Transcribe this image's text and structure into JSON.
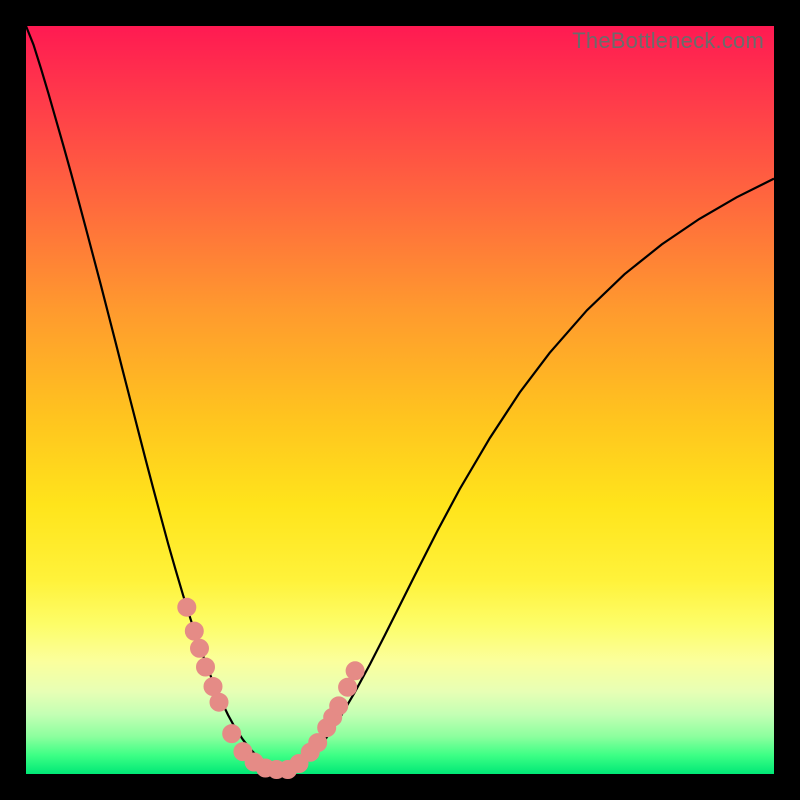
{
  "watermark": "TheBottleneck.com",
  "colors": {
    "top": "#ff1a52",
    "bottom": "#00e876",
    "marker": "#e58b86",
    "line": "#000000"
  },
  "chart_data": {
    "type": "line",
    "title": "",
    "xlabel": "",
    "ylabel": "",
    "xlim": [
      0,
      100
    ],
    "ylim": [
      0,
      100
    ],
    "x": [
      0,
      1,
      2,
      3,
      4,
      5,
      6,
      7,
      8,
      9,
      10,
      11,
      12,
      13,
      14,
      15,
      16,
      17,
      18,
      19,
      20,
      21,
      22,
      23,
      24,
      25,
      26,
      27,
      28,
      29,
      30,
      31,
      32,
      33,
      34,
      35,
      36,
      38,
      40,
      42,
      44,
      46,
      48,
      50,
      52,
      55,
      58,
      62,
      66,
      70,
      75,
      80,
      85,
      90,
      95,
      100
    ],
    "values": [
      100,
      97.5,
      94.3,
      91.0,
      87.5,
      84.0,
      80.4,
      76.7,
      73.0,
      69.2,
      65.4,
      61.5,
      57.6,
      53.7,
      49.8,
      45.9,
      42.0,
      38.2,
      34.5,
      30.8,
      27.3,
      23.9,
      20.7,
      17.7,
      14.9,
      12.3,
      10.0,
      7.9,
      6.1,
      4.6,
      3.3,
      2.3,
      1.5,
      0.9,
      0.5,
      0.3,
      0.8,
      2.2,
      4.6,
      7.6,
      11.0,
      14.7,
      18.6,
      22.6,
      26.6,
      32.5,
      38.1,
      44.9,
      51.0,
      56.3,
      62.0,
      66.8,
      70.8,
      74.2,
      77.1,
      79.6
    ],
    "markers": {
      "x": [
        21.5,
        22.5,
        23.2,
        24.0,
        25.0,
        25.8,
        27.5,
        29.0,
        30.5,
        32.0,
        33.5,
        35.0,
        36.5,
        38.0,
        39.0,
        40.2,
        41.0,
        41.8,
        43.0,
        44.0
      ],
      "y": [
        22.3,
        19.1,
        16.8,
        14.3,
        11.7,
        9.6,
        5.4,
        3.0,
        1.6,
        0.8,
        0.6,
        0.6,
        1.4,
        2.9,
        4.2,
        6.2,
        7.6,
        9.1,
        11.6,
        13.8
      ]
    }
  }
}
